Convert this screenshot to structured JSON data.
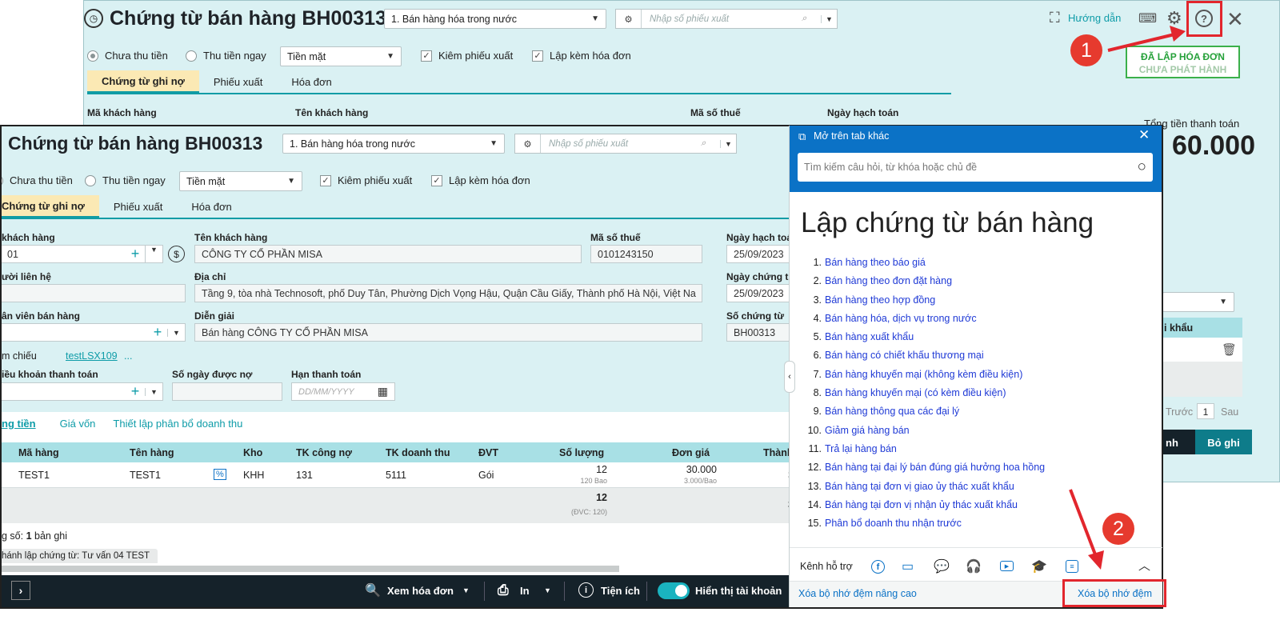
{
  "back": {
    "title": "Chứng từ bán hàng BH00313",
    "type_select": "1. Bán hàng hóa trong nước",
    "search_placeholder": "Nhập số phiếu xuất",
    "guide": "Hướng dẫn",
    "radio_unpaid": "Chưa thu tiền",
    "radio_paid": "Thu tiền ngay",
    "payment_method": "Tiền mặt",
    "chk_delivery": "Kiêm phiếu xuất",
    "chk_invoice": "Lập kèm hóa đơn",
    "tabs": [
      "Chứng từ ghi nợ",
      "Phiếu xuất",
      "Hóa đơn"
    ],
    "status_line1": "ĐÃ LẬP HÓA ĐƠN",
    "status_line2": "CHƯA PHÁT HÀNH",
    "labels": {
      "customer_code": "Mã khách hàng",
      "customer_name": "Tên khách hàng",
      "tax_code": "Mã số thuế",
      "posting_date": "Ngày hạch toán"
    },
    "total_label": "Tổng tiền thanh toán",
    "total_value": "60.000",
    "col_discount": "i khẩu",
    "pager_prev": "Trước",
    "pager_page": "1",
    "pager_next": "Sau",
    "btn_save_partial": "nh",
    "btn_cancel": "Bỏ ghi"
  },
  "front": {
    "title": "Chứng từ bán hàng BH00313",
    "type_select": "1. Bán hàng hóa trong nước",
    "search_placeholder": "Nhập số phiếu xuất",
    "radio_unpaid": "Chưa thu tiền",
    "radio_paid": "Thu tiền ngay",
    "payment_method": "Tiền mặt",
    "chk_delivery": "Kiêm phiếu xuất",
    "chk_invoice": "Lập kèm hóa đơn",
    "tabs": [
      "Chứng từ ghi nợ",
      "Phiếu xuất",
      "Hóa đơn"
    ],
    "form": {
      "customer_code_label": "khách hàng",
      "customer_code_value": "01",
      "customer_name_label": "Tên khách hàng",
      "customer_name_value": "CÔNG TY CỔ PHẦN MISA",
      "tax_code_label": "Mã số thuế",
      "tax_code_value": "0101243150",
      "posting_date_label": "Ngày hạch toá",
      "posting_date_value": "25/09/2023",
      "contact_label": "ười liên hệ",
      "address_label": "Địa chỉ",
      "address_value": "Tầng 9, tòa nhà Technosoft, phố Duy Tân, Phường Dịch Vọng Hậu, Quận Cầu Giấy, Thành phố Hà Nội, Việt Na",
      "voucher_date_label": "Ngày chứng từ",
      "voucher_date_value": "25/09/2023",
      "salesperson_label": "ân viên bán hàng",
      "description_label": "Diễn giải",
      "description_value": "Bán hàng CÔNG TY CỔ PHẦN MISA",
      "voucher_no_label": "Số chứng từ",
      "voucher_no_value": "BH00313",
      "ref_label": "m chiếu",
      "ref_link": "testLSX109",
      "ref_more": "...",
      "terms_label": "iều khoản thanh toán",
      "debt_days_label": "Số ngày được nợ",
      "due_date_label": "Hạn thanh toán",
      "due_date_placeholder": "DD/MM/YYYY"
    },
    "subtabs": [
      "ng tiền",
      "Giá vốn",
      "Thiết lập phân bổ doanh thu"
    ],
    "grid": {
      "headers": [
        "Mã hàng",
        "Tên hàng",
        "Kho",
        "TK công nợ",
        "TK doanh thu",
        "ĐVT",
        "Số lượng",
        "Đơn giá",
        "Thành"
      ],
      "row": {
        "code": "TEST1",
        "name": "TEST1",
        "warehouse": "KHH",
        "debit": "131",
        "revenue": "5111",
        "unit": "Gói",
        "qty": "12",
        "qty_sub": "120 Bao",
        "price": "30.000",
        "price_sub": "3.000/Bao",
        "amount": "3"
      },
      "total_qty": "12",
      "total_qty_sub": "(ĐVC: 120)",
      "total_amount": "3"
    },
    "record_count_prefix": "g số: ",
    "record_count_num": "1",
    "record_count_suffix": " bản ghi",
    "creator": "hánh lập chứng từ: Tư vấn 04 TEST",
    "toolbar": {
      "view_invoice": "Xem hóa đơn",
      "print": "In",
      "utilities": "Tiện ích",
      "show_account": "Hiển thị tài khoản"
    }
  },
  "help": {
    "open_new_tab": "Mở trên tab khác",
    "search_placeholder": "Tìm kiếm câu hỏi, từ khóa hoặc chủ đề",
    "heading": "Lập chứng từ bán hàng",
    "items": [
      "Bán hàng theo báo giá",
      "Bán hàng theo đơn đặt hàng",
      "Bán hàng theo hợp đồng",
      "Bán hàng hóa, dịch vụ trong nước",
      "Bán hàng xuất khẩu",
      "Bán hàng có chiết khấu thương mại",
      "Bán hàng khuyến mại (không kèm điều kiện)",
      "Bán hàng khuyến mại (có kèm điều kiện)",
      "Bán hàng thông qua các đại lý",
      "Giảm giá hàng bán",
      "Trả lại hàng bán",
      "Bán hàng tại đại lý bán đúng giá hưởng hoa hồng",
      "Bán hàng tại đơn vị giao ủy thác xuất khẩu",
      "Bán hàng tại đơn vị nhận ủy thác xuất khẩu",
      "Phân bổ doanh thu nhận trước"
    ],
    "support_label": "Kênh hỗ trợ",
    "clear_cache_advanced": "Xóa bộ nhớ đệm nâng cao",
    "clear_cache": "Xóa bộ nhớ đệm"
  },
  "callouts": {
    "one": "1",
    "two": "2"
  },
  "colors": {
    "accent": "#0e9ca8",
    "help_blue": "#0b72c6",
    "callout_red": "#e2262d",
    "grid_header": "#a8e0e5",
    "active_tab": "#fbe9b4"
  }
}
